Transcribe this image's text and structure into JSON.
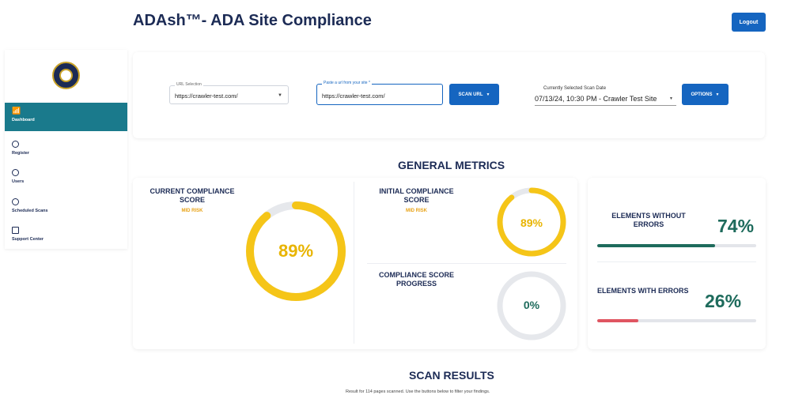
{
  "app": {
    "title": "ADAsh™- ADA Site Compliance",
    "logout_label": "Logout"
  },
  "sidebar": {
    "logo_icon": "seal-logo-icon",
    "items": [
      {
        "label": "Dashboard",
        "icon": "wifi-icon",
        "active": true
      },
      {
        "label": "Register",
        "icon": "circle-icon",
        "active": false
      },
      {
        "label": "Users",
        "icon": "circle-icon",
        "active": false
      },
      {
        "label": "Scheduled Scans",
        "icon": "circle-icon",
        "active": false
      },
      {
        "label": "Support Center",
        "icon": "grid-icon",
        "active": false
      }
    ]
  },
  "controls": {
    "url_selection": {
      "label": "URL Selection",
      "value": "https://crawler-test.com/"
    },
    "url_input": {
      "label": "Paste a url from your site *",
      "value": "https://crawler-test.com/"
    },
    "scan_url_label": "SCAN URL",
    "scan_date": {
      "label": "Currently Selected Scan Date",
      "value": "07/13/24, 10:30 PM - Crawler Test Site"
    },
    "options_label": "OPTIONS"
  },
  "general_metrics": {
    "title": "GENERAL METRICS",
    "current_score": {
      "label": "CURRENT COMPLIANCE SCORE",
      "risk": "MID RISK",
      "value": "89%",
      "fraction": 0.89
    },
    "initial_score": {
      "label": "INITIAL COMPLIANCE SCORE",
      "risk": "MID RISK",
      "value": "89%",
      "fraction": 0.89
    },
    "progress": {
      "label": "COMPLIANCE SCORE PROGRESS",
      "value": "0%",
      "fraction": 0
    },
    "without_errors": {
      "label": "ELEMENTS WITHOUT ERRORS",
      "value": "74%",
      "fraction": 0.74
    },
    "with_errors": {
      "label": "ELEMENTS WITH ERRORS",
      "value": "26%",
      "fraction": 0.26
    }
  },
  "colors": {
    "gauge": "#f5c518",
    "track": "#e6e8ec",
    "good": "#1e6b5c",
    "bad": "#e05561",
    "accent": "#1565c0",
    "nav_active": "#1a7a8c",
    "risk": "#e8a317"
  },
  "scan_results": {
    "title": "SCAN RESULTS",
    "note": "Result for 114 pages scanned. Use the buttons below to filter your findings."
  }
}
